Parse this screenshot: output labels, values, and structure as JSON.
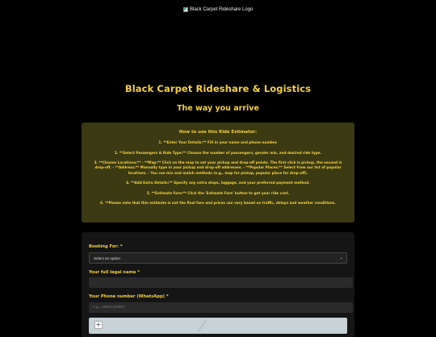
{
  "logo": {
    "alt": "Black Carpet Rideshare Logo"
  },
  "header": {
    "title": "Black Carpet Rideshare & Logistics",
    "tagline": "The way you arrive"
  },
  "howto": {
    "title": "How to use this Ride Estimator:",
    "steps": [
      "1. **Enter Your Details:** Fill in your name and phone number.",
      "2. **Select Passengers & Ride Type:** Choose the number of passengers, gender mix, and desired ride type.",
      "3. **Choose Locations:** - **Map:** Click on the map to set your pickup and drop-off points. The first click is pickup, the second is drop-off. - **Address:** Manually type in your pickup and drop-off addresses. - **Popular Places:** Select from our list of popular locations. - You can mix and match methods (e.g., map for pickup, popular place for drop-off).",
      "4. **Add Extra Details:** Specify any extra stops, luggage, and your preferred payment method.",
      "5. **Estimate Fare:** Click the 'Estimate Fare' button to get your ride cost.",
      "6. **Please note that this estimate is not the final fare and prices can vary based on traffic, delays and weather conditions."
    ]
  },
  "form": {
    "booking_label": "Booking For: *",
    "booking_selected": "Select an option",
    "name_label": "Your full legal name *",
    "name_value": "",
    "phone_label": "Your Phone number (WhatsApp) *",
    "phone_placeholder": "e.g., 18681234567"
  },
  "map": {
    "zoom_in": "+"
  },
  "colors": {
    "accent": "#f4d03f",
    "background": "#000000",
    "panel": "#3b3a12",
    "card": "#151515"
  }
}
